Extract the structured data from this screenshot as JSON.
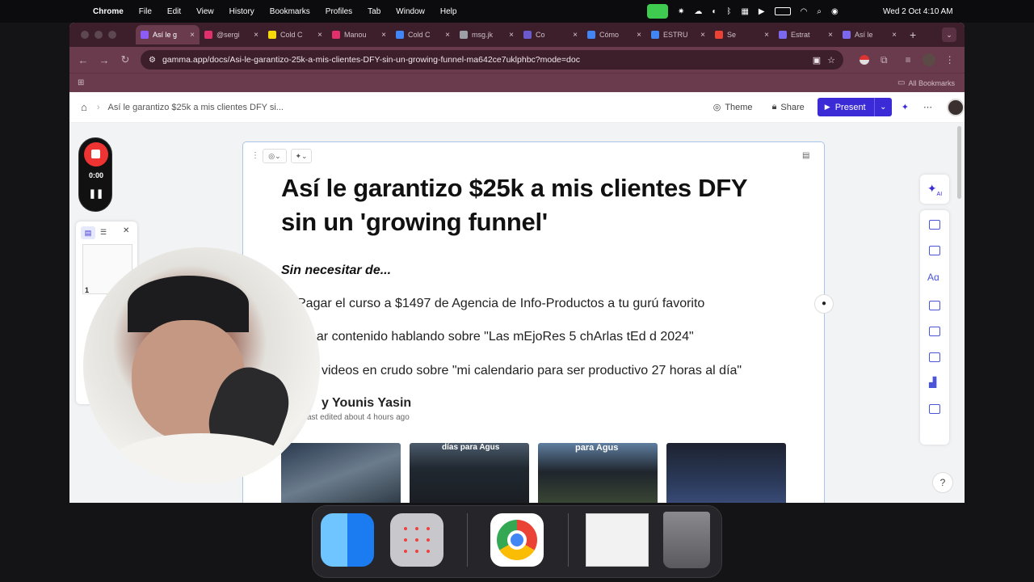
{
  "menubar": {
    "app_name": "Chrome",
    "items": [
      "File",
      "Edit",
      "View",
      "History",
      "Bookmarks",
      "Profiles",
      "Tab",
      "Window",
      "Help"
    ],
    "datetime": "Wed 2 Oct  4:10 AM"
  },
  "tabs": [
    {
      "label": "Así le g",
      "color": "#8b5cf6",
      "active": true
    },
    {
      "label": "@sergi",
      "color": "#e1306c"
    },
    {
      "label": "Cold C",
      "color": "#f5d90a"
    },
    {
      "label": "Manou",
      "color": "#e1306c"
    },
    {
      "label": "Cold C",
      "color": "#4285f4"
    },
    {
      "label": "msg.jk",
      "color": "#9aa0a6"
    },
    {
      "label": "Co",
      "color": "#6a5acd"
    },
    {
      "label": "Cómo",
      "color": "#4285f4"
    },
    {
      "label": "ESTRU",
      "color": "#4285f4"
    },
    {
      "label": "Se",
      "color": "#ea4335"
    },
    {
      "label": "Estrat",
      "color": "#7b68ee"
    },
    {
      "label": "Así le",
      "color": "#7b68ee"
    }
  ],
  "address": {
    "url": "gamma.app/docs/Asi-le-garantizo-25k-a-mis-clientes-DFY-sin-un-growing-funnel-ma642ce7uklphbc?mode=doc"
  },
  "bookmarks": {
    "all_label": "All Bookmarks"
  },
  "app": {
    "breadcrumb": "Así le garantizo $25k a mis clientes DFY si...",
    "theme_label": "Theme",
    "share_label": "Share",
    "present_label": "Present"
  },
  "recorder": {
    "time": "0:00"
  },
  "doc": {
    "title": "Así le garantizo $25k a mis clientes DFY sin un 'growing funnel'",
    "subtitle": "Sin necesitar de...",
    "bullets": [
      "Pagar el curso a $1497 de Agencia de Info-Productos a tu gurú favorito",
      "ear contenido hablando sobre \"Las mEjoRes 5 chArlas tEd d 2024\"",
      "videos en crudo sobre \"mi calendario para ser productivo 27 horas al día\""
    ],
    "author": "y Younis Yasin",
    "edited": "ast edited about 4 hours ago",
    "thumb_captions": [
      "",
      "días para Agus",
      "para Agus",
      ""
    ]
  },
  "right_toolbar": {
    "ai_badge": "AI"
  },
  "help": {
    "label": "?"
  },
  "sidebar_panel": {
    "page_number": "1"
  },
  "colors": {
    "accent": "#3b2bd6",
    "chrome_frame": "#6a3b4d",
    "tab_bar": "#3d1f2c"
  }
}
